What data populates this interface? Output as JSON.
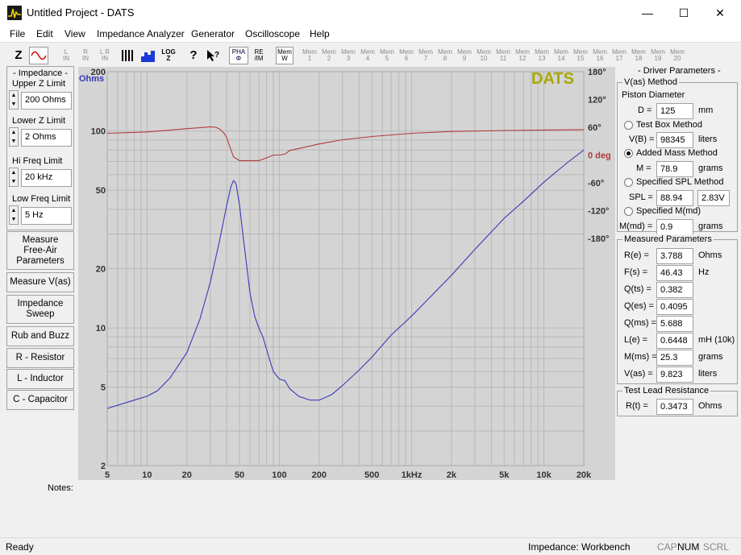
{
  "window": {
    "title": "Untitled Project - DATS",
    "min_glyph": "—",
    "max_glyph": "☐",
    "close_glyph": "✕"
  },
  "menu": [
    "File",
    "Edit",
    "View",
    "Impedance Analyzer",
    "Generator",
    "Oscilloscope",
    "Help"
  ],
  "toolbar": {
    "z_label": "Z",
    "lr": [
      "L\nIN",
      "R\nIN",
      "L R\nIN"
    ],
    "log_label": "LOG\nZ",
    "help_label": "?",
    "pha_label": "PHA\nΦ",
    "re_label": "RE\n/IM",
    "mem_label": "Mem\nW",
    "mems": [
      "Mem\n1",
      "Mem\n2",
      "Mem\n3",
      "Mem\n4",
      "Mem\n5",
      "Mem\n6",
      "Mem\n7",
      "Mem\n8",
      "Mem\n9",
      "Mem\n10",
      "Mem\n11",
      "Mem\n12",
      "Mem\n13",
      "Mem\n14",
      "Mem\n15",
      "Mem\n16",
      "Mem\n17",
      "Mem\n18",
      "Mem\n19",
      "Mem\n20"
    ]
  },
  "left": {
    "group_title": "- Impedance -",
    "upper": {
      "label": "Upper Z Limit",
      "value": "200 Ohms"
    },
    "lower": {
      "label": "Lower Z Limit",
      "value": "2 Ohms"
    },
    "hi": {
      "label": "Hi Freq Limit",
      "value": "20 kHz"
    },
    "low": {
      "label": "Low Freq Limit",
      "value": "5 Hz"
    },
    "buttons": [
      "Measure\nFree-Air\nParameters",
      "Measure V(as)",
      "Impedance\nSweep",
      "Rub and Buzz",
      "R - Resistor",
      "L - Inductor",
      "C - Capacitor"
    ]
  },
  "chart_data": {
    "type": "line",
    "brand": "DATS",
    "x_scale": "log",
    "xlim": [
      5,
      20000
    ],
    "x_ticks": [
      "5",
      "10",
      "20",
      "50",
      "100",
      "200",
      "500",
      "1kHz",
      "2k",
      "5k",
      "10k",
      "20k"
    ],
    "y_scale": "log",
    "ylim": [
      2,
      200
    ],
    "y_unit": "Ohms",
    "y_ticks": [
      "200",
      "100",
      "50",
      "20",
      "10",
      "5",
      "2"
    ],
    "phase_ticks": [
      "180°",
      "120°",
      "60°",
      "0 deg",
      "-60°",
      "-120°",
      "-180°"
    ],
    "phase_lim": [
      -180,
      180
    ],
    "grid": true,
    "colors": {
      "impedance": "#3a3ab8",
      "phase": "#b33a3a",
      "brand": "#a8a800",
      "bg": "#d4d4d4",
      "grid": "#b8b8b8"
    },
    "series": [
      {
        "axis": "impedance",
        "x": [
          5,
          8,
          10,
          12,
          15,
          20,
          25,
          30,
          35,
          40,
          43,
          45,
          47,
          50,
          53,
          57,
          60,
          65,
          70,
          75,
          80,
          85,
          90,
          100,
          110,
          120,
          140,
          170,
          200,
          250,
          300,
          400,
          500,
          700,
          1000,
          2000,
          3000,
          5000,
          7000,
          10000,
          15000,
          20000
        ],
        "y": [
          3.9,
          4.3,
          4.5,
          4.8,
          5.6,
          7.5,
          11,
          17,
          27,
          42,
          52,
          56,
          54,
          42,
          30,
          20,
          15,
          11.5,
          10,
          9,
          7.8,
          6.8,
          6,
          5.5,
          5.4,
          4.9,
          4.5,
          4.3,
          4.3,
          4.6,
          5.1,
          6.1,
          7.1,
          9.2,
          11.5,
          18.5,
          25,
          36,
          44,
          55,
          69,
          80
        ]
      },
      {
        "axis": "phase",
        "x": [
          5,
          10,
          15,
          20,
          25,
          30,
          33,
          35,
          38,
          40,
          42,
          45,
          50,
          60,
          70,
          80,
          90,
          100,
          110,
          120,
          150,
          200,
          300,
          500,
          1000,
          2000,
          5000,
          10000,
          20000
        ],
        "y": [
          47,
          50,
          54,
          57,
          59,
          61,
          60,
          57,
          48,
          38,
          20,
          -4,
          -12,
          -12,
          -12,
          -6,
          0,
          0,
          2,
          10,
          16,
          24,
          33,
          40,
          47,
          51,
          53,
          54,
          55
        ]
      }
    ]
  },
  "right": {
    "title": "- Driver Parameters -",
    "vas_method": {
      "title": "V(as) Method",
      "piston": "Piston Diameter",
      "d_label": "D =",
      "d_value": "125",
      "d_unit": "mm",
      "testbox": "Test Box Method",
      "vb_label": "V(B) =",
      "vb_value": "98345",
      "vb_unit": "liters",
      "addedmass": "Added Mass Method",
      "m_label": "M =",
      "m_value": "78.9",
      "m_unit": "grams",
      "spl": "Specified SPL Method",
      "spl_label": "SPL =",
      "spl_value": "88.94",
      "spl_volt": "2.83V",
      "mmd": "Specified M(md)",
      "mmd_label": "M(md) =",
      "mmd_value": "0.9",
      "mmd_unit": "grams"
    },
    "measured": {
      "title": "Measured Parameters",
      "rows": [
        {
          "label": "R(e) =",
          "value": "3.788",
          "unit": "Ohms"
        },
        {
          "label": "F(s) =",
          "value": "46.43",
          "unit": "Hz"
        },
        {
          "label": "Q(ts) =",
          "value": "0.382",
          "unit": ""
        },
        {
          "label": "Q(es) =",
          "value": "0.4095",
          "unit": ""
        },
        {
          "label": "Q(ms) =",
          "value": "5.688",
          "unit": ""
        },
        {
          "label": "L(e) =",
          "value": "0.6448",
          "unit": "mH (10k)"
        },
        {
          "label": "M(ms) =",
          "value": "25.3",
          "unit": "grams"
        },
        {
          "label": "V(as) =",
          "value": "9.823",
          "unit": "liters"
        }
      ]
    },
    "lead": {
      "title": "Test Lead Resistance",
      "label": "R(t) =",
      "value": "0.3473",
      "unit": "Ohms"
    }
  },
  "notes_label": "Notes:",
  "status": {
    "left": "Ready",
    "mode": "Impedance: Workbench",
    "cap": "CAP",
    "num": "NUM",
    "scrl": "SCRL"
  }
}
